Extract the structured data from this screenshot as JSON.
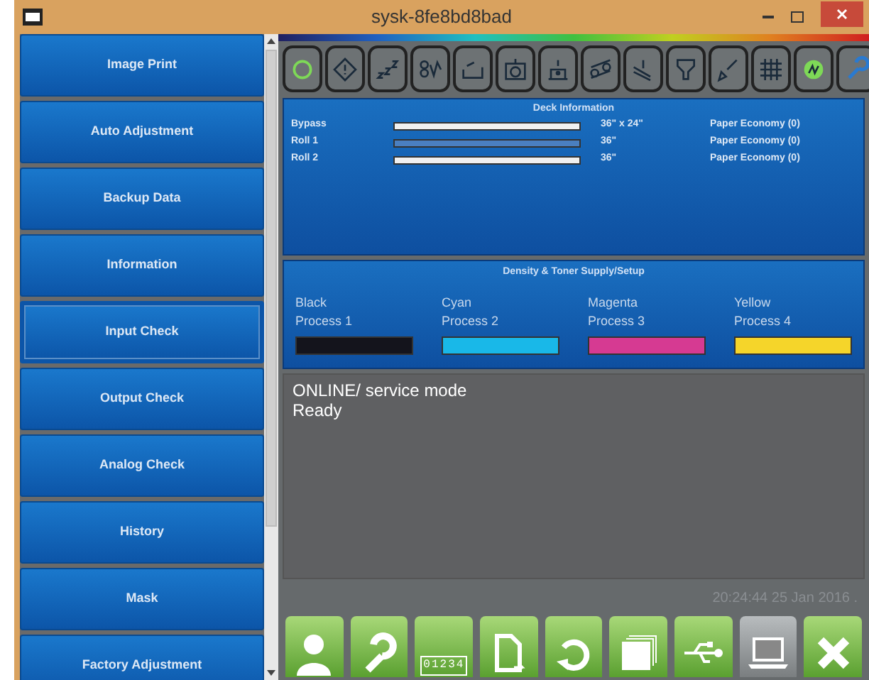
{
  "window": {
    "title": "sysk-8fe8bd8bad"
  },
  "sidebar": {
    "items": [
      {
        "label": "Image Print",
        "selected": false
      },
      {
        "label": "Auto Adjustment",
        "selected": false
      },
      {
        "label": "Backup Data",
        "selected": false
      },
      {
        "label": "Information",
        "selected": false
      },
      {
        "label": "Input Check",
        "selected": true
      },
      {
        "label": "Output Check",
        "selected": false
      },
      {
        "label": "Analog Check",
        "selected": false
      },
      {
        "label": "History",
        "selected": false
      },
      {
        "label": "Mask",
        "selected": false
      },
      {
        "label": "Factory Adjustment",
        "selected": false
      }
    ]
  },
  "toolbar": [
    {
      "kind": "ring"
    },
    {
      "kind": "warning"
    },
    {
      "kind": "sleep"
    },
    {
      "kind": "wave"
    },
    {
      "kind": "tray"
    },
    {
      "kind": "roll"
    },
    {
      "kind": "stack"
    },
    {
      "kind": "rollers"
    },
    {
      "kind": "sheets"
    },
    {
      "kind": "filter"
    },
    {
      "kind": "brush"
    },
    {
      "kind": "grid"
    },
    {
      "kind": "power"
    },
    {
      "kind": "wrench"
    }
  ],
  "deck": {
    "title": "Deck Information",
    "rows": [
      {
        "name": "Bypass",
        "highlighted": false,
        "size": "36\" x 24\"",
        "mode": "Paper Economy (0)"
      },
      {
        "name": "Roll 1",
        "highlighted": true,
        "size": "36\"",
        "mode": "Paper Economy (0)"
      },
      {
        "name": "Roll 2",
        "highlighted": false,
        "size": "36\"",
        "mode": "Paper Economy (0)"
      }
    ]
  },
  "toner": {
    "title": "Density & Toner Supply/Setup",
    "items": [
      {
        "name": "Black",
        "process": "Process 1",
        "color": "#14141c"
      },
      {
        "name": "Cyan",
        "process": "Process 2",
        "color": "#19b8e8"
      },
      {
        "name": "Magenta",
        "process": "Process 3",
        "color": "#d63a92"
      },
      {
        "name": "Yellow",
        "process": "Process 4",
        "color": "#f5d52a"
      }
    ]
  },
  "status": {
    "lines": [
      "ONLINE/ service mode",
      "Ready"
    ]
  },
  "timestamp": "20:24:44 25 Jan 2016 .",
  "bottom_buttons": [
    {
      "kind": "user"
    },
    {
      "kind": "wrench"
    },
    {
      "kind": "counter",
      "label": "01234"
    },
    {
      "kind": "document"
    },
    {
      "kind": "refresh"
    },
    {
      "kind": "pages"
    },
    {
      "kind": "usb"
    },
    {
      "kind": "laptop",
      "disabled": true
    },
    {
      "kind": "close"
    }
  ]
}
